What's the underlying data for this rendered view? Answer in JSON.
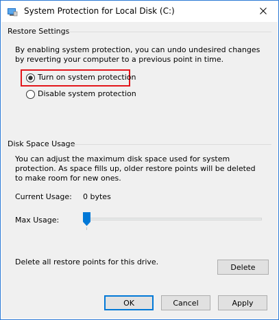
{
  "window": {
    "title": "System Protection for Local Disk (C:)",
    "accent_color": "#0078d7"
  },
  "restore_settings": {
    "group_label": "Restore Settings",
    "description": "By enabling system protection, you can undo undesired changes by reverting your computer to a previous point in time.",
    "options": [
      {
        "label": "Turn on system protection",
        "selected": true,
        "highlighted": true
      },
      {
        "label": "Disable system protection",
        "selected": false,
        "highlighted": false
      }
    ],
    "highlight_color": "#e3151a"
  },
  "disk_space": {
    "group_label": "Disk Space Usage",
    "description": "You can adjust the maximum disk space used for system protection. As space fills up, older restore points will be deleted to make room for new ones.",
    "current_usage_label": "Current Usage:",
    "current_usage_value": "0 bytes",
    "max_usage_label": "Max Usage:",
    "max_usage_fraction": 0.0,
    "delete_text": "Delete all restore points for this drive.",
    "delete_button": "Delete"
  },
  "footer": {
    "ok": "OK",
    "cancel": "Cancel",
    "apply": "Apply"
  }
}
